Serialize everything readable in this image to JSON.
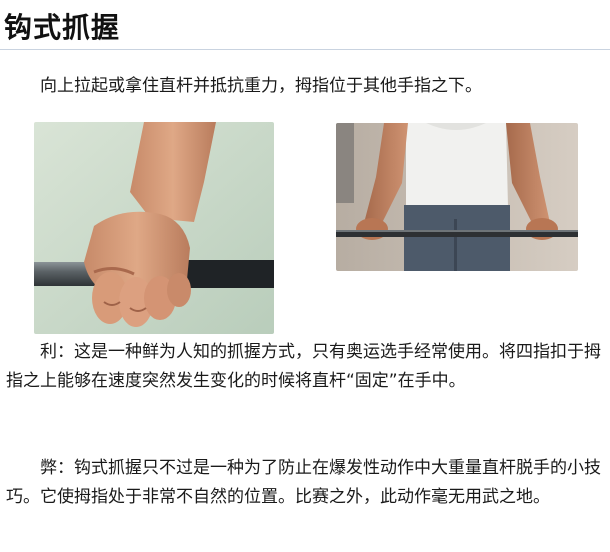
{
  "heading": {
    "title": "钩式抓握"
  },
  "intro": {
    "text": "向上拉起或拿住直杆并抵抗重力，拇指位于其他手指之下。"
  },
  "images": [
    {
      "subject": "hand-hook-grip-closeup-photo"
    },
    {
      "subject": "athlete-holding-barbell-photo"
    }
  ],
  "pros": {
    "text": "利：这是一种鲜为人知的抓握方式，只有奥运选手经常使用。将四指扣于拇指之上能够在速度突然发生变化的时候将直杆“固定”在手中。"
  },
  "cons": {
    "text": "弊：钩式抓握只不过是一种为了防止在爆发性动作中大重量直杆脱手的小技巧。它使拇指处于非常不自然的位置。比赛之外，此动作毫无用武之地。"
  }
}
